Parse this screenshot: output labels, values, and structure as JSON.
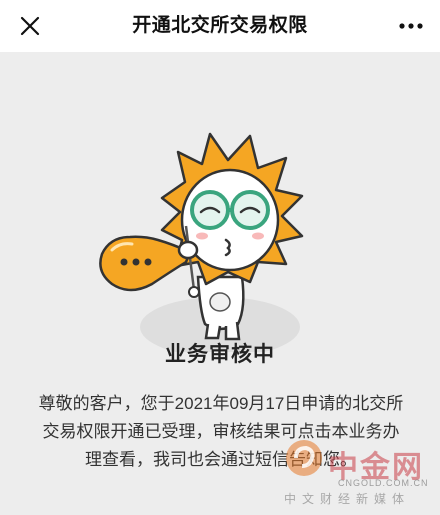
{
  "header": {
    "title": "开通北交所交易权限",
    "close_icon": "close-icon",
    "more_icon": "more-icon"
  },
  "status": {
    "title": "业务审核中",
    "message": "尊敬的客户，您于2021年09月17日申请的北交所交易权限开通已受理，审核结果可点击本业务办理查看，我司也会通过短信告知您。"
  },
  "illustration": {
    "icon": "mascot-blowing-bubble-illustration",
    "bubble_text": "..."
  },
  "watermark": {
    "brand": "中金网",
    "domain": "CNGOLD.COM.CN",
    "slogan": "中文财经新媒体"
  },
  "colors": {
    "background": "#ededed",
    "header_bg": "#ffffff",
    "mascot_orange": "#f5a623",
    "watermark_red": "#c83c46"
  }
}
